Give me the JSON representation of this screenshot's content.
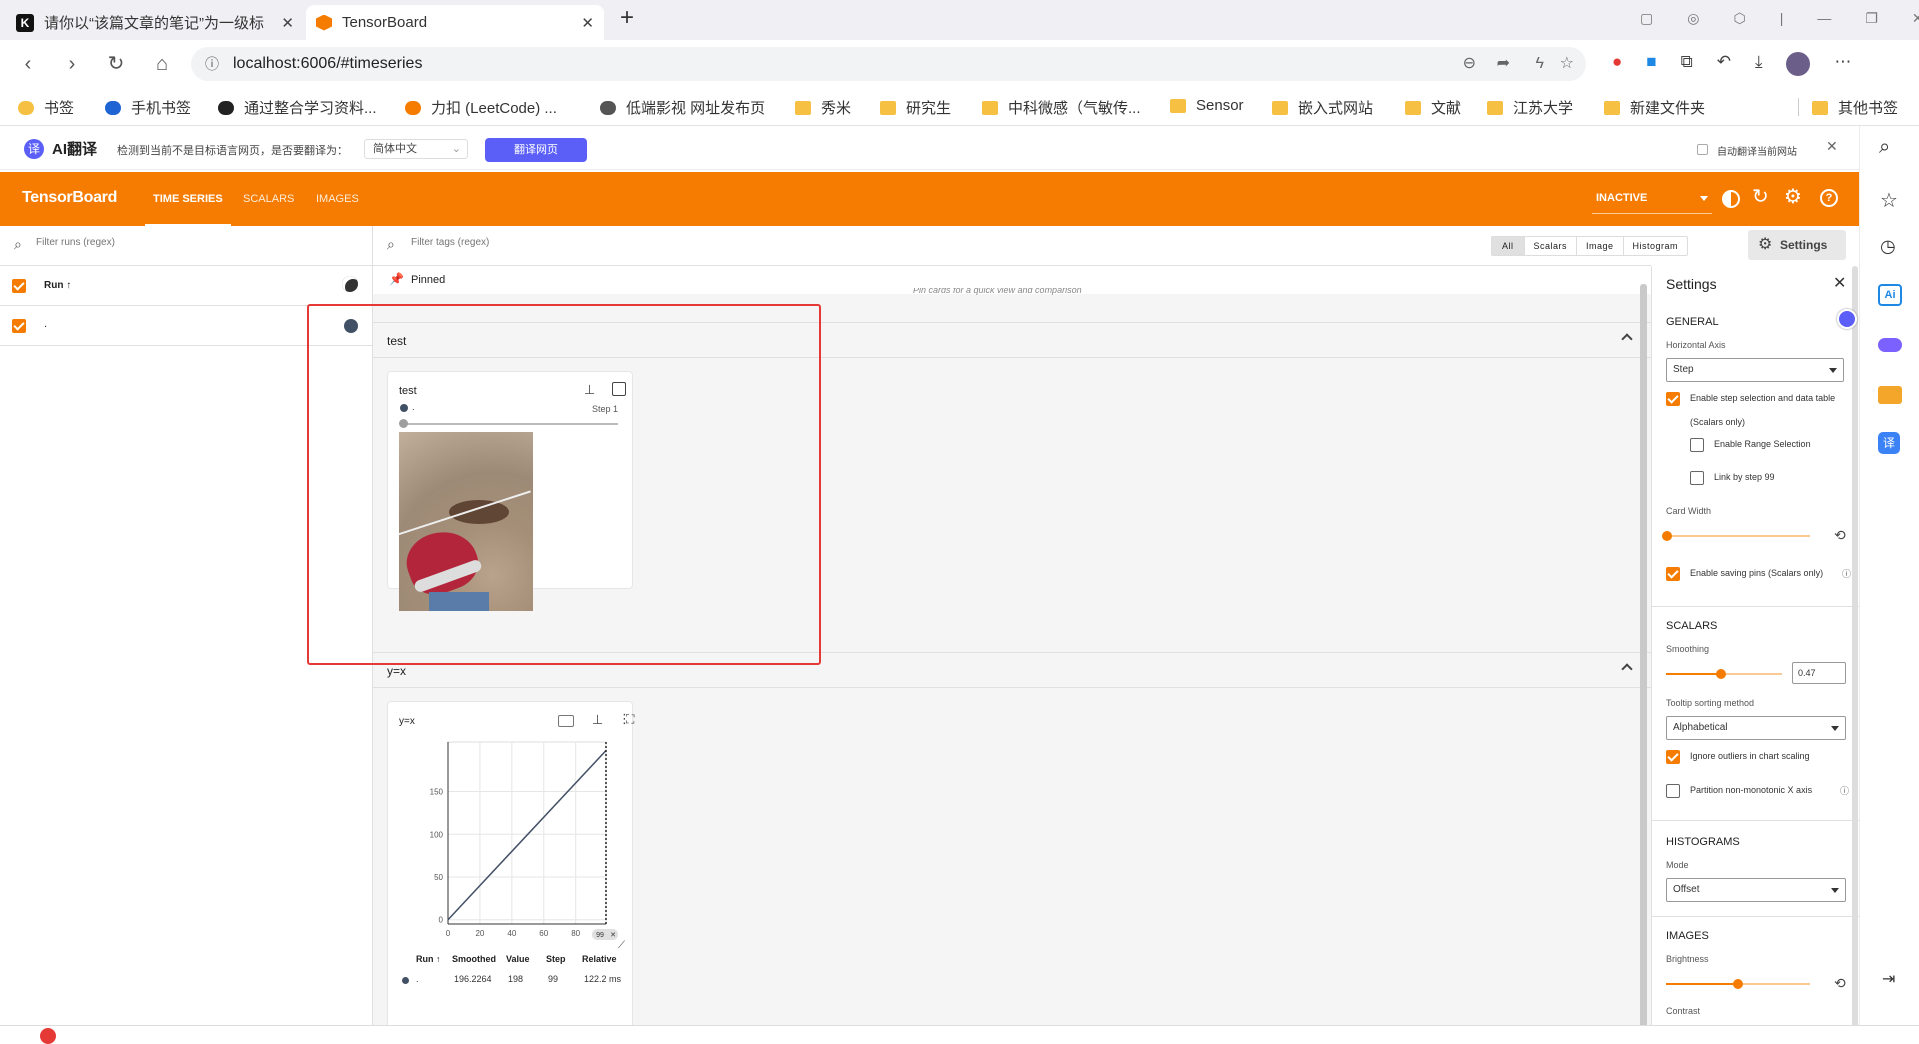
{
  "browser": {
    "tabs": [
      {
        "title": "请你以“该篇文章的笔记”为一级标",
        "favicon": "K"
      },
      {
        "title": "TensorBoard",
        "favicon": "tb"
      }
    ],
    "new_tab": "+",
    "url": "localhost:6006/#timeseries"
  },
  "bookmarks": [
    "书签",
    "手机书签",
    "通过整合学习资料...",
    "力扣 (LeetCode) ...",
    "低端影视 网址发布页",
    "秀米",
    "研究生",
    "中科微感（气敏传...",
    "Sensor",
    "嵌入式网站",
    "文献",
    "江苏大学",
    "新建文件夹",
    "其他书签"
  ],
  "translate_bar": {
    "brand": "AI翻译",
    "message": "检测到当前不是目标语言网页，是否要翻译为：",
    "language": "简体中文",
    "button": "翻译网页",
    "auto_label": "自动翻译当前网站"
  },
  "tb": {
    "brand": "TensorBoard",
    "nav": [
      "TIME SERIES",
      "SCALARS",
      "IMAGES"
    ],
    "status": "INACTIVE",
    "accent": "#f57c00"
  },
  "runs": {
    "filter_placeholder": "Filter runs (regex)",
    "header": "Run ↑",
    "items": [
      {
        "name": ".",
        "color": "#425066"
      }
    ]
  },
  "main": {
    "filter_placeholder": "Filter tags (regex)",
    "type_filters": [
      "All",
      "Scalars",
      "Image",
      "Histogram"
    ],
    "settings_button": "Settings",
    "pinned_label": "Pinned",
    "pinned_hint": "Pin cards for a quick view and comparison",
    "groups": [
      {
        "name": "test",
        "card": {
          "title": "test",
          "run": ".",
          "step_label": "Step 1"
        }
      },
      {
        "name": "y=x",
        "card": {
          "title": "y=x",
          "table_headers": [
            "Run ↑",
            "Smoothed",
            "Value",
            "Step",
            "Relative"
          ],
          "table_row": [
            ".",
            "196.2264",
            "198",
            "99",
            "122.2 ms"
          ],
          "step_marker": "99"
        }
      }
    ]
  },
  "chart_data": {
    "type": "line",
    "title": "y=x",
    "xlabel": "",
    "ylabel": "",
    "x": [
      0,
      99
    ],
    "series": [
      {
        "values": [
          0,
          198
        ]
      }
    ],
    "xticks": [
      0,
      20,
      40,
      60,
      80
    ],
    "yticks": [
      0,
      50,
      100,
      150
    ],
    "xlim": [
      0,
      99
    ],
    "ylim": [
      -5,
      208
    ],
    "grid": true
  },
  "settings": {
    "title": "Settings",
    "general": "GENERAL",
    "horizontal_axis_label": "Horizontal Axis",
    "horizontal_axis_value": "Step",
    "enable_step_selection": "Enable step selection and data table",
    "scalars_only": "(Scalars only)",
    "enable_range": "Enable Range Selection",
    "link_by_step": "Link by step 99",
    "card_width": "Card Width",
    "enable_saving_pins": "Enable saving pins (Scalars only)",
    "scalars": "SCALARS",
    "smoothing_label": "Smoothing",
    "smoothing_value": "0.47",
    "smoothing_fraction": 0.47,
    "tooltip_label": "Tooltip sorting method",
    "tooltip_value": "Alphabetical",
    "ignore_outliers": "Ignore outliers in chart scaling",
    "partition": "Partition non-monotonic X axis",
    "histograms": "HISTOGRAMS",
    "mode_label": "Mode",
    "mode_value": "Offset",
    "images": "IMAGES",
    "brightness": "Brightness",
    "contrast": "Contrast"
  }
}
